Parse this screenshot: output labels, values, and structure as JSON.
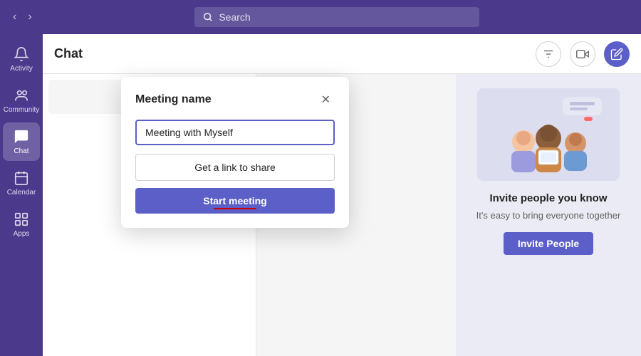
{
  "topbar": {
    "search_placeholder": "Search"
  },
  "sidebar": {
    "items": [
      {
        "id": "activity",
        "label": "Activity",
        "active": false
      },
      {
        "id": "community",
        "label": "Community",
        "active": false
      },
      {
        "id": "chat",
        "label": "Chat",
        "active": true
      },
      {
        "id": "calendar",
        "label": "Calendar",
        "active": false
      },
      {
        "id": "apps",
        "label": "Apps",
        "active": false
      }
    ]
  },
  "chat_header": {
    "title": "Chat",
    "video_btn_label": "video",
    "compose_btn_label": "compose",
    "filter_btn_label": "filter"
  },
  "modal": {
    "title": "Meeting name",
    "meeting_name_value": "Meeting with Myself",
    "get_link_label": "Get a link to share",
    "start_meeting_label": "Start meeting"
  },
  "right_panel": {
    "invite_title": "Invite people you kno",
    "invite_desc": "It's easy to bring everyone together",
    "invite_btn_label": "Invite People"
  },
  "colors": {
    "sidebar_bg": "#4b3a8c",
    "accent": "#5b5fc7",
    "accent_dark": "#4a4eb5",
    "red_underline": "#cc0000"
  }
}
